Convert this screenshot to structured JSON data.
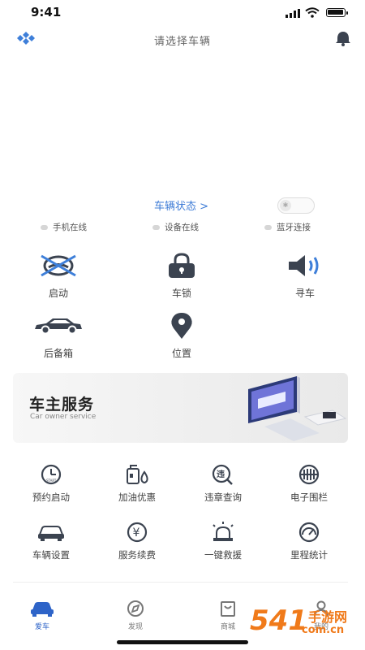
{
  "status_bar": {
    "time": "9:41"
  },
  "header": {
    "title": "请选择车辆"
  },
  "vehicle": {
    "status_link": "车辆状态 >",
    "indicators": [
      "手机在线",
      "设备在线",
      "蓝牙连接"
    ]
  },
  "controls": [
    {
      "label": "启动",
      "icon": "engine-start-icon"
    },
    {
      "label": "车锁",
      "icon": "lock-icon"
    },
    {
      "label": "寻车",
      "icon": "horn-icon"
    },
    {
      "label": "后备箱",
      "icon": "trunk-car-icon"
    },
    {
      "label": "位置",
      "icon": "location-pin-icon"
    }
  ],
  "banner": {
    "title": "车主服务",
    "subtitle": "Car owner service"
  },
  "services": [
    {
      "label": "预约启动",
      "icon": "clock-icon"
    },
    {
      "label": "加油优惠",
      "icon": "fuel-icon"
    },
    {
      "label": "违章查询",
      "icon": "violation-search-icon"
    },
    {
      "label": "电子围栏",
      "icon": "fence-icon"
    },
    {
      "label": "车辆设置",
      "icon": "car-settings-icon"
    },
    {
      "label": "服务续费",
      "icon": "yuan-icon"
    },
    {
      "label": "一键救援",
      "icon": "siren-icon"
    },
    {
      "label": "里程统计",
      "icon": "gauge-icon"
    }
  ],
  "tabs": [
    {
      "label": "爱车",
      "icon": "car-icon",
      "active": true
    },
    {
      "label": "发现",
      "icon": "compass-icon",
      "active": false
    },
    {
      "label": "商城",
      "icon": "shop-bag-icon",
      "active": false
    },
    {
      "label": "我的",
      "icon": "user-icon",
      "active": false
    }
  ],
  "watermark": {
    "number": "541",
    "text_top": "手游网",
    "text_bottom": "com.cn"
  },
  "colors": {
    "accent": "#3d7bd6",
    "icon_dark": "#3b4350",
    "icon_blue": "#3e7fd9",
    "watermark": "#f07a1a"
  }
}
